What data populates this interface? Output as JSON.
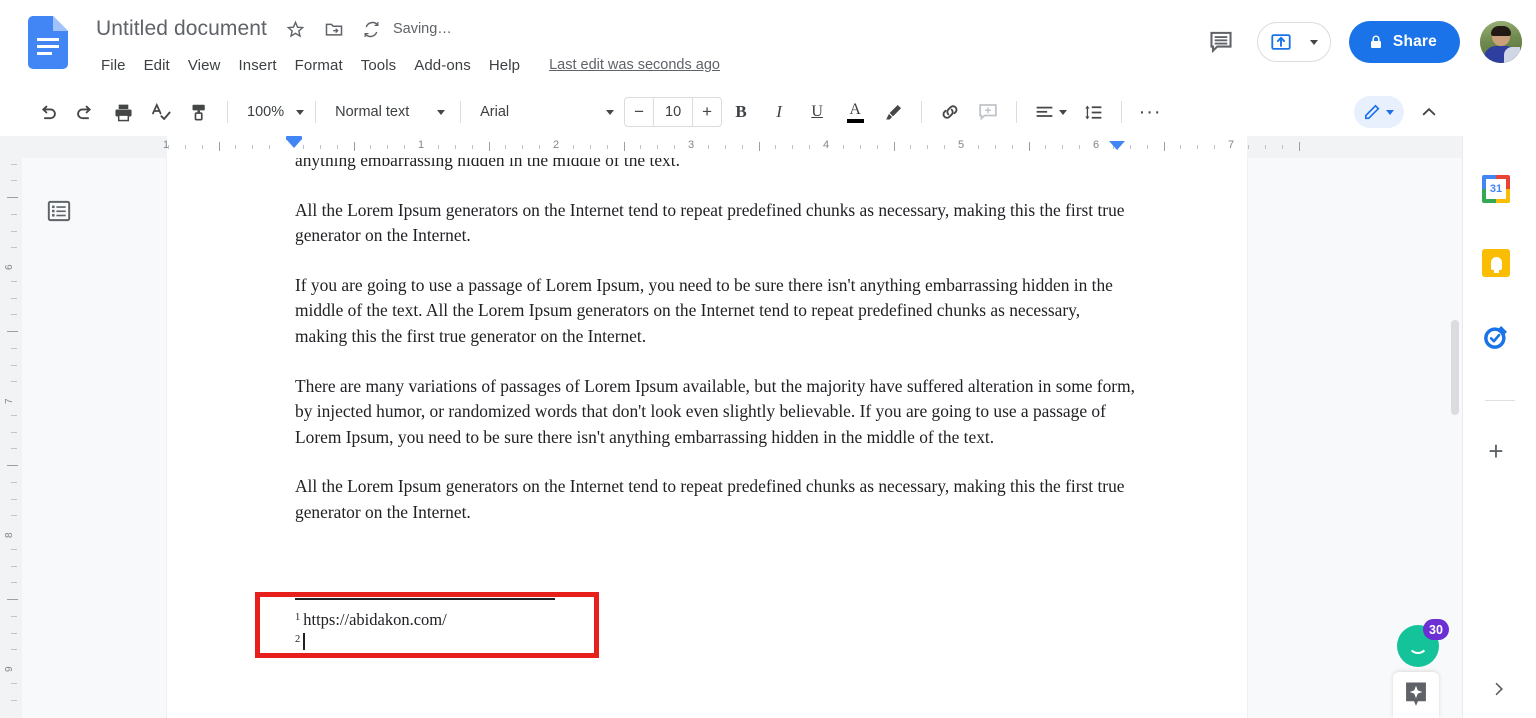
{
  "header": {
    "logo_icon": "google-docs-logo",
    "doc_title": "Untitled document",
    "star_icon": "star-icon",
    "move_icon": "move-to-folder-icon",
    "saving_icon": "saving-sync-icon",
    "saving_status": "Saving…",
    "menus": [
      "File",
      "Edit",
      "View",
      "Insert",
      "Format",
      "Tools",
      "Add-ons",
      "Help"
    ],
    "last_edit": "Last edit was seconds ago",
    "history_icon": "comment-history-icon",
    "mode_icon": "present-upload-icon",
    "mode_caret_icon": "chevron-down-icon",
    "share_lock_icon": "lock-icon",
    "share_label": "Share",
    "avatar_name": "user-avatar"
  },
  "toolbar": {
    "undo_icon": "undo-icon",
    "redo_icon": "redo-icon",
    "print_icon": "print-icon",
    "spellcheck_icon": "spellcheck-icon",
    "paint_icon": "paint-format-icon",
    "zoom_value": "100%",
    "zoom_caret_icon": "chevron-down-icon",
    "style_value": "Normal text",
    "style_caret_icon": "chevron-down-icon",
    "font_value": "Arial",
    "font_caret_icon": "chevron-down-icon",
    "size_minus": "−",
    "size_value": "10",
    "size_plus": "+",
    "bold_label": "B",
    "italic_label": "I",
    "underline_label": "U",
    "textcolor_label": "A",
    "textcolor_swatch": "#000000",
    "highlight_icon": "highlight-pen-icon",
    "link_icon": "insert-link-icon",
    "comment_icon": "add-comment-icon",
    "align_icon": "align-left-icon",
    "align_caret_icon": "chevron-down-icon",
    "linespacing_icon": "line-spacing-icon",
    "more_label": "···",
    "edit_mode_icon": "pencil-edit-icon",
    "edit_mode_caret_icon": "chevron-down-icon",
    "collapse_icon": "chevron-up-icon",
    "accent_color": "#1a73e8"
  },
  "ruler": {
    "labels": [
      "1",
      "2",
      "3",
      "4",
      "5",
      "6",
      "7"
    ],
    "left_label": "1",
    "left_indent_icon": "left-indent-marker",
    "right_indent_icon": "right-indent-marker"
  },
  "vruler": {
    "labels": [
      "6",
      "7",
      "8",
      "9"
    ]
  },
  "document": {
    "outline_icon": "document-outline-icon",
    "paragraphs": [
      "anything embarrassing hidden in the middle of the text.",
      "All the Lorem Ipsum generators on the Internet tend to repeat predefined chunks as necessary, making this the first true generator on the Internet.",
      "If you are going to use a passage of Lorem Ipsum, you need to be sure there isn't anything embarrassing hidden in the middle of the text. All the Lorem Ipsum generators on the Internet tend to repeat predefined chunks as necessary, making this the first true generator on the Internet.",
      "There are many variations of passages of Lorem Ipsum available, but the majority have suffered alteration in some form, by injected humor, or randomized words that don't look even slightly believable. If you are going to use a passage of Lorem Ipsum, you need to be sure there isn't anything embarrassing hidden in the middle of the text.",
      "All the Lorem Ipsum generators on the Internet tend to repeat predefined chunks as necessary, making this the first true generator on the Internet."
    ],
    "footnotes": [
      {
        "number": "1",
        "text": "https://abidakon.com/"
      },
      {
        "number": "2",
        "text": ""
      }
    ],
    "highlight_color": "#e8201c"
  },
  "side_panel": {
    "items": [
      {
        "name": "google-calendar-icon",
        "label": "31"
      },
      {
        "name": "google-keep-icon",
        "label": ""
      },
      {
        "name": "google-tasks-icon",
        "label": ""
      }
    ],
    "add_label": "+"
  },
  "floating": {
    "grammar_icon": "grammarly-assistant-icon",
    "grammar_badge": "30",
    "explore_icon": "explore-sparkle-icon",
    "expand_icon": "chevron-right-icon"
  }
}
